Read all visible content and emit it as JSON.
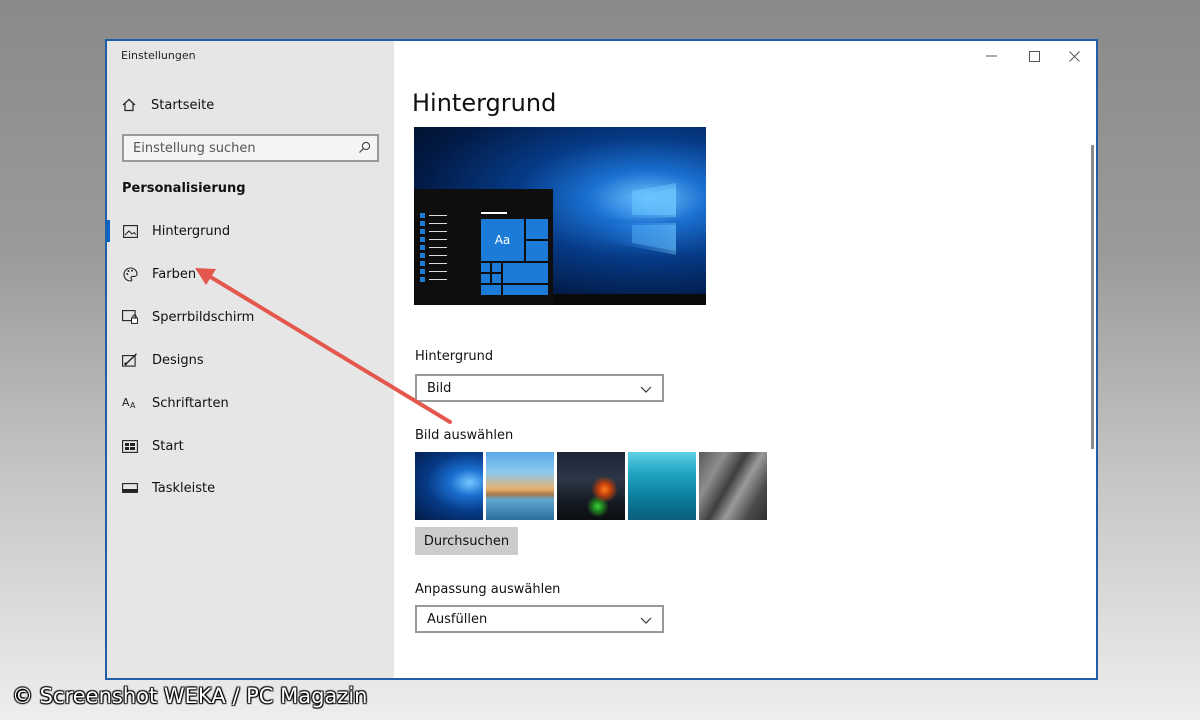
{
  "window": {
    "title": "Einstellungen",
    "controls": [
      "minimize",
      "maximize",
      "close"
    ]
  },
  "sidebar": {
    "home_label": "Startseite",
    "search": {
      "placeholder": "Einstellung suchen"
    },
    "section_heading": "Personalisierung",
    "items": [
      {
        "label": "Hintergrund",
        "icon": "picture-icon",
        "active": true
      },
      {
        "label": "Farben",
        "icon": "palette-icon",
        "active": false
      },
      {
        "label": "Sperrbildschirm",
        "icon": "lock-screen-icon",
        "active": false
      },
      {
        "label": "Designs",
        "icon": "brush-icon",
        "active": false
      },
      {
        "label": "Schriftarten",
        "icon": "fonts-icon",
        "active": false
      },
      {
        "label": "Start",
        "icon": "start-icon",
        "active": false
      },
      {
        "label": "Taskleiste",
        "icon": "taskbar-icon",
        "active": false
      }
    ]
  },
  "main": {
    "title": "Hintergrund",
    "preview_tile_text": "Aa",
    "background_label": "Hintergrund",
    "background_value": "Bild",
    "choose_picture_label": "Bild auswählen",
    "thumbnails": [
      "windows-hero",
      "beach-rocks",
      "night-sky-tent",
      "underwater-swimmer",
      "rock-cliff"
    ],
    "browse_label": "Durchsuchen",
    "fit_label": "Anpassung auswählen",
    "fit_value": "Ausfüllen"
  },
  "annotation": {
    "arrow_color": "#e4574c"
  },
  "credit": "© Screenshot WEKA / PC Magazin",
  "colors": {
    "accent": "#0a64c8",
    "window_border": "#1f5fa6"
  }
}
